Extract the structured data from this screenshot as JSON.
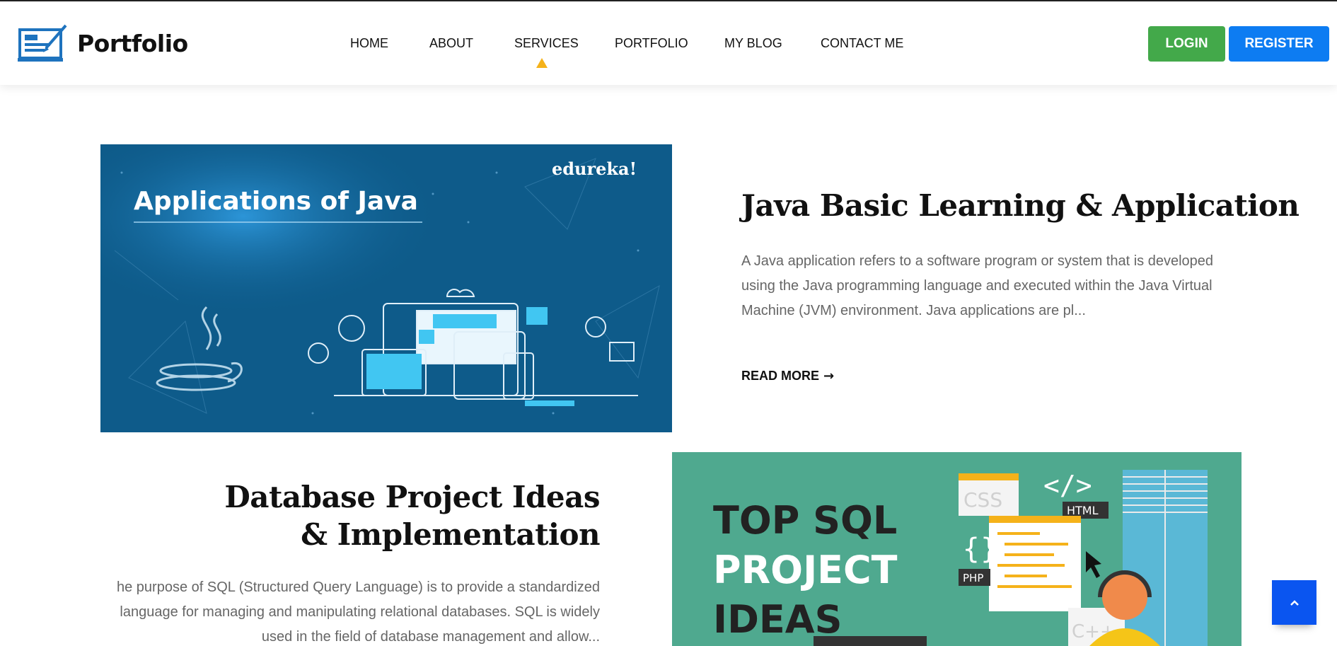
{
  "brand": {
    "name": "Portfolio"
  },
  "nav": {
    "items": [
      "HOME",
      "ABOUT",
      "SERVICES",
      "PORTFOLIO",
      "MY BLOG",
      "CONTACT ME"
    ],
    "active": "SERVICES"
  },
  "auth": {
    "login_label": "LOGIN",
    "register_label": "REGISTER"
  },
  "colors": {
    "login": "#43a94a",
    "register": "#0d7cf2",
    "active_caret": "#f5b21a",
    "scroll_top": "#0a55f0"
  },
  "posts": [
    {
      "title": "Java Basic Learning & Application",
      "excerpt": "A Java application refers to a software program or system that is developed using the Java programming language and executed within the Java Virtual Machine (JVM) environment. Java applications are pl...",
      "read_more": "READ MORE",
      "image": {
        "heading": "Applications of Java",
        "brand": "edureka!"
      }
    },
    {
      "title": "Database Project Ideas & Implementation",
      "excerpt": "he purpose of SQL (Structured Query Language) is to provide a standardized language for managing and manipulating relational databases. SQL is widely used in the field of database management and allow...",
      "image": {
        "line1": "TOP SQL",
        "line2": "PROJECT",
        "line3": "IDEAS",
        "tags": [
          "CSS",
          "HTML",
          "PHP",
          "C++"
        ]
      }
    }
  ],
  "icons": {
    "scroll_top": "chevron-up-icon",
    "read_more": "arrow-right-icon"
  }
}
